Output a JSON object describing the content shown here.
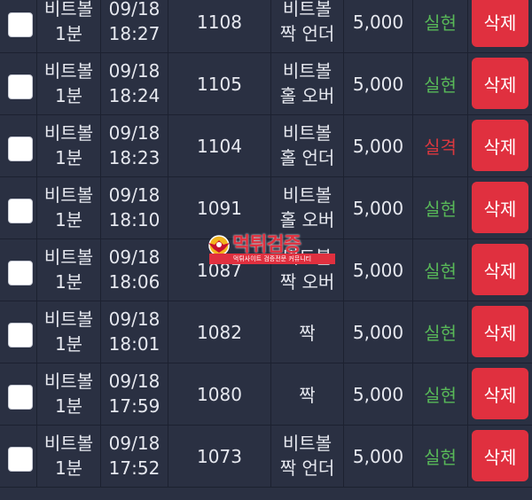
{
  "rows": [
    {
      "game": [
        "비트볼",
        "1분"
      ],
      "date": "09/18",
      "time": "18:27",
      "round": "1108",
      "pick": [
        "비트볼",
        "짝 언더"
      ],
      "amount": "5,000",
      "result": "실현",
      "result_status": "win",
      "delete_label": "삭제"
    },
    {
      "game": [
        "비트볼",
        "1분"
      ],
      "date": "09/18",
      "time": "18:24",
      "round": "1105",
      "pick": [
        "비트볼",
        "홀 오버"
      ],
      "amount": "5,000",
      "result": "실현",
      "result_status": "win",
      "delete_label": "삭제"
    },
    {
      "game": [
        "비트볼",
        "1분"
      ],
      "date": "09/18",
      "time": "18:23",
      "round": "1104",
      "pick": [
        "비트볼",
        "홀 언더"
      ],
      "amount": "5,000",
      "result": "실격",
      "result_status": "loss",
      "delete_label": "삭제"
    },
    {
      "game": [
        "비트볼",
        "1분"
      ],
      "date": "09/18",
      "time": "18:10",
      "round": "1091",
      "pick": [
        "비트볼",
        "홀 오버"
      ],
      "amount": "5,000",
      "result": "실현",
      "result_status": "win",
      "delete_label": "삭제"
    },
    {
      "game": [
        "비트볼",
        "1분"
      ],
      "date": "09/18",
      "time": "18:06",
      "round": "1087",
      "pick": [
        "비트볼",
        "짝 오버"
      ],
      "amount": "5,000",
      "result": "실현",
      "result_status": "win",
      "delete_label": "삭제"
    },
    {
      "game": [
        "비트볼",
        "1분"
      ],
      "date": "09/18",
      "time": "18:01",
      "round": "1082",
      "pick": [
        "짝"
      ],
      "amount": "5,000",
      "result": "실현",
      "result_status": "win",
      "delete_label": "삭제"
    },
    {
      "game": [
        "비트볼",
        "1분"
      ],
      "date": "09/18",
      "time": "17:59",
      "round": "1080",
      "pick": [
        "짝"
      ],
      "amount": "5,000",
      "result": "실현",
      "result_status": "win",
      "delete_label": "삭제"
    },
    {
      "game": [
        "비트볼",
        "1분"
      ],
      "date": "09/18",
      "time": "17:52",
      "round": "1073",
      "pick": [
        "비트볼",
        "짝 언더"
      ],
      "amount": "5,000",
      "result": "실현",
      "result_status": "win",
      "delete_label": "삭제"
    }
  ],
  "watermark": {
    "title": "먹튀검증",
    "subtitle": "먹튀사이트 검증전문 커뮤니티"
  },
  "colors": {
    "background": "#2a3042",
    "win": "#58b858",
    "loss": "#d9383f",
    "delete_button": "#e0303f"
  },
  "icons": {
    "checkbox": "checkbox-unchecked-icon",
    "watermark_emblem": "eagle-emblem-icon"
  }
}
